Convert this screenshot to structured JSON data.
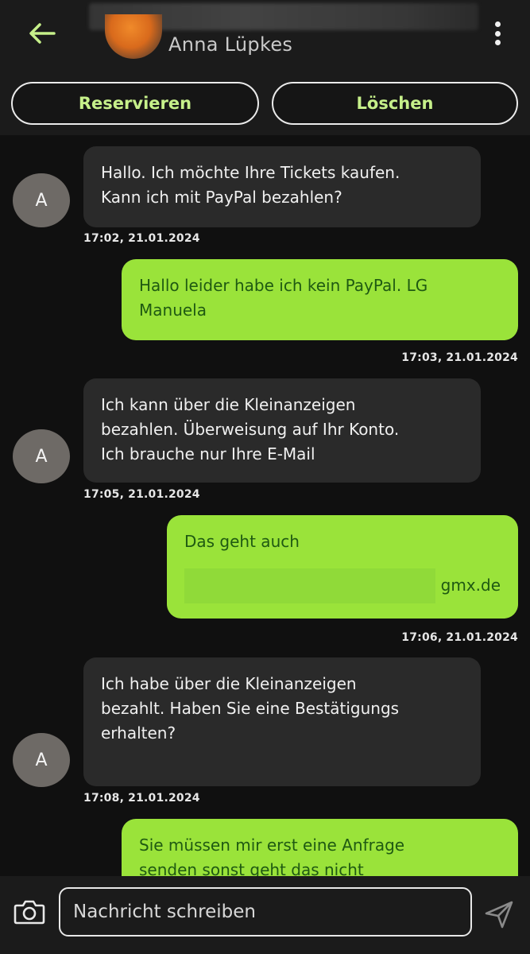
{
  "header": {
    "contact_name": "Anna Lüpkes",
    "reserve_label": "Reservieren",
    "delete_label": "Löschen"
  },
  "messages": [
    {
      "direction": "incoming",
      "avatar": "A",
      "lines": [
        "Hallo. Ich möchte Ihre Tickets kaufen.",
        "Kann ich mit PayPal bezahlen?"
      ],
      "timestamp": "17:02, 21.01.2024"
    },
    {
      "direction": "outgoing",
      "lines": [
        "Hallo leider habe ich kein PayPal. LG",
        "Manuela"
      ],
      "timestamp": "17:03, 21.01.2024"
    },
    {
      "direction": "incoming",
      "avatar": "A",
      "lines": [
        "Ich kann über die Kleinanzeigen",
        "bezahlen. Überweisung auf Ihr Konto.",
        "Ich brauche nur Ihre E-Mail"
      ],
      "timestamp": "17:05, 21.01.2024"
    },
    {
      "direction": "outgoing",
      "lines": [
        "Das geht auch"
      ],
      "email_suffix": "gmx.de",
      "timestamp": "17:06, 21.01.2024"
    },
    {
      "direction": "incoming",
      "avatar": "A",
      "lines": [
        "Ich habe über die Kleinanzeigen",
        "bezahlt. Haben Sie eine Bestätigungs",
        "erhalten?"
      ],
      "timestamp": "17:08, 21.01.2024"
    },
    {
      "direction": "outgoing",
      "lines": [
        "Sie müssen mir erst eine Anfrage",
        "senden sonst geht das nicht"
      ]
    }
  ],
  "composer": {
    "placeholder": "Nachricht schreiben"
  },
  "icons": {
    "back": "arrow-left-icon",
    "menu": "more-vertical-icon",
    "camera": "camera-icon",
    "send": "send-icon"
  },
  "colors": {
    "accent": "#9ae33a",
    "accent_text": "#1f5a12",
    "button_text": "#c6f08a",
    "incoming_bubble": "#2a2a2a",
    "background": "#101010"
  }
}
